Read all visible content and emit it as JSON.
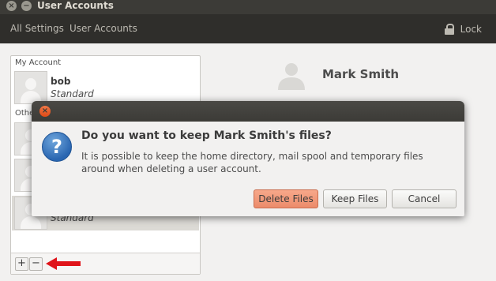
{
  "window": {
    "title": "User Accounts"
  },
  "toolbar": {
    "breadcrumb": [
      "All Settings",
      "User Accounts"
    ],
    "lock_label": "Lock"
  },
  "user_list": {
    "my_account_label": "My Account",
    "other_accounts_label": "Othe",
    "me": {
      "name": "bob",
      "type": "Standard"
    },
    "selected_partial_type": "Standard"
  },
  "detail": {
    "name": "Mark Smith"
  },
  "dialog": {
    "heading": "Do you want to keep Mark Smith's files?",
    "body": "It is possible to keep the home directory, mail spool and temporary files around when deleting a user account.",
    "buttons": {
      "delete": "Delete Files",
      "keep": "Keep Files",
      "cancel": "Cancel"
    }
  },
  "controls": {
    "add": "+",
    "remove": "−"
  },
  "icons": {
    "close": "close-icon",
    "minimize": "minimize-icon",
    "lock": "lock-icon",
    "avatar": "avatar-icon",
    "question": "question-icon",
    "arrow": "red-arrow-icon"
  },
  "colors": {
    "accent_delete": "#ec8b6b",
    "arrow": "#e0141a",
    "titlebar": "#3c3b37"
  }
}
